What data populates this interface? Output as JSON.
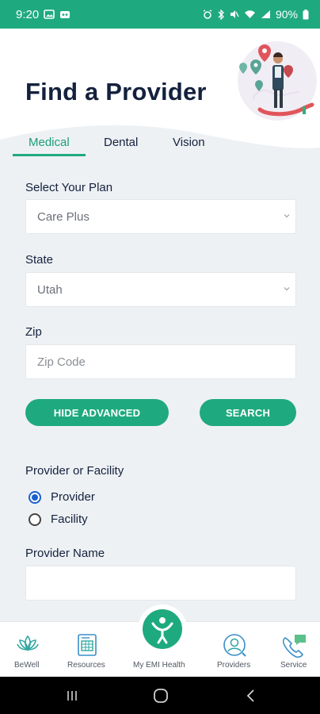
{
  "status_bar": {
    "time": "9:20",
    "battery": "90%"
  },
  "header": {
    "title": "Find a Provider"
  },
  "tabs": [
    {
      "label": "Medical",
      "active": true
    },
    {
      "label": "Dental",
      "active": false
    },
    {
      "label": "Vision",
      "active": false
    }
  ],
  "form": {
    "plan_label": "Select Your Plan",
    "plan_value": "Care Plus",
    "state_label": "State",
    "state_value": "Utah",
    "zip_label": "Zip",
    "zip_placeholder": "Zip Code",
    "hide_advanced_label": "HIDE ADVANCED",
    "search_label": "SEARCH",
    "provider_or_facility_label": "Provider or Facility",
    "options": [
      {
        "label": "Provider",
        "checked": true
      },
      {
        "label": "Facility",
        "checked": false
      }
    ],
    "provider_name_label": "Provider Name",
    "provider_name_value": ""
  },
  "bottom_nav": {
    "items": [
      {
        "label": "BeWell",
        "icon": "lotus-icon"
      },
      {
        "label": "Resources",
        "icon": "document-icon"
      },
      {
        "label": "My EMI Health",
        "icon": "person-icon"
      },
      {
        "label": "Providers",
        "icon": "provider-search-icon"
      },
      {
        "label": "Service",
        "icon": "phone-chat-icon"
      }
    ]
  },
  "colors": {
    "accent": "#1eaa7e",
    "title": "#14213d",
    "background": "#eef1f4"
  }
}
